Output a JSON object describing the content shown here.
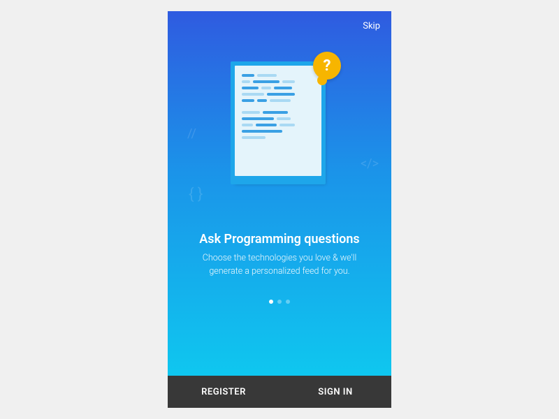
{
  "header": {
    "skip_label": "Skip"
  },
  "illustration": {
    "bubble_glyph": "?"
  },
  "content": {
    "title": "Ask Programming questions",
    "subtitle": "Choose the technologies you love & we'll generate a personalized feed for you."
  },
  "pager": {
    "total": 3,
    "active_index": 0
  },
  "footer": {
    "register_label": "REGISTER",
    "signin_label": "SIGN IN"
  },
  "colors": {
    "accent_yellow": "#f7b500",
    "gradient_top": "#2f5be0",
    "gradient_bottom": "#0dcff0",
    "footer_bg": "#383838"
  }
}
